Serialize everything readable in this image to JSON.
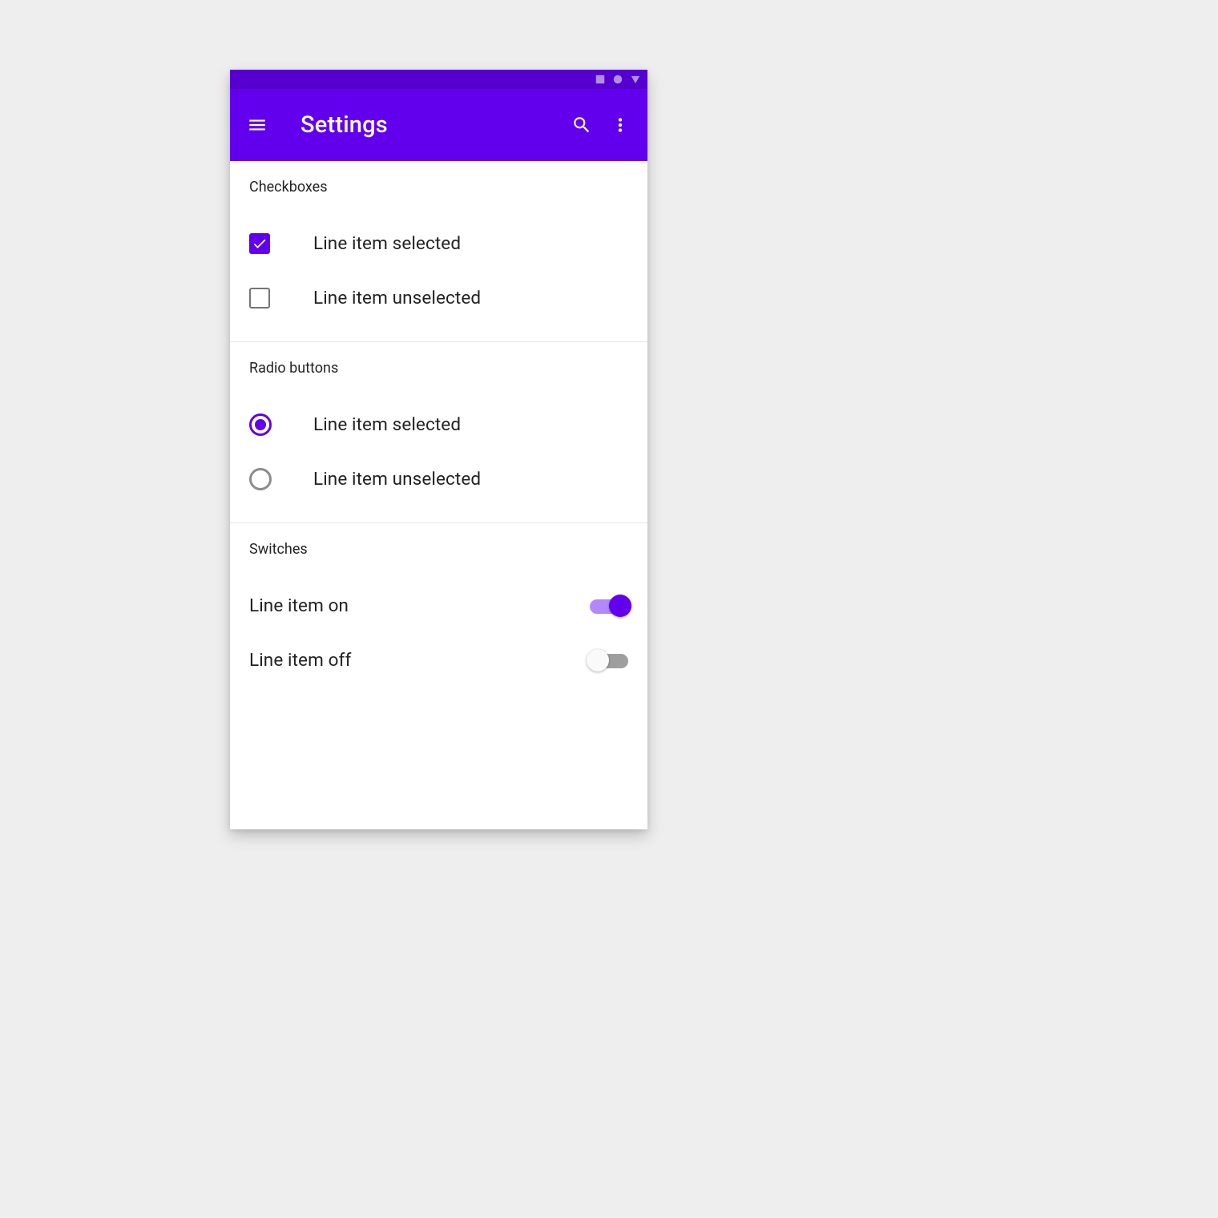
{
  "colors": {
    "primary": "#6200ee",
    "primaryDark": "#5500cf",
    "switchTrackOn": "#b388ff",
    "switchTrackOff": "#9e9e9e"
  },
  "header": {
    "title": "Settings"
  },
  "sections": {
    "checkboxes": {
      "title": "Checkboxes",
      "items": [
        {
          "label": "Line item selected",
          "checked": true
        },
        {
          "label": "Line item unselected",
          "checked": false
        }
      ]
    },
    "radios": {
      "title": "Radio buttons",
      "items": [
        {
          "label": "Line item selected",
          "selected": true
        },
        {
          "label": "Line item unselected",
          "selected": false
        }
      ]
    },
    "switches": {
      "title": "Switches",
      "items": [
        {
          "label": "Line item on",
          "on": true
        },
        {
          "label": "Line item off",
          "on": false
        }
      ]
    }
  }
}
